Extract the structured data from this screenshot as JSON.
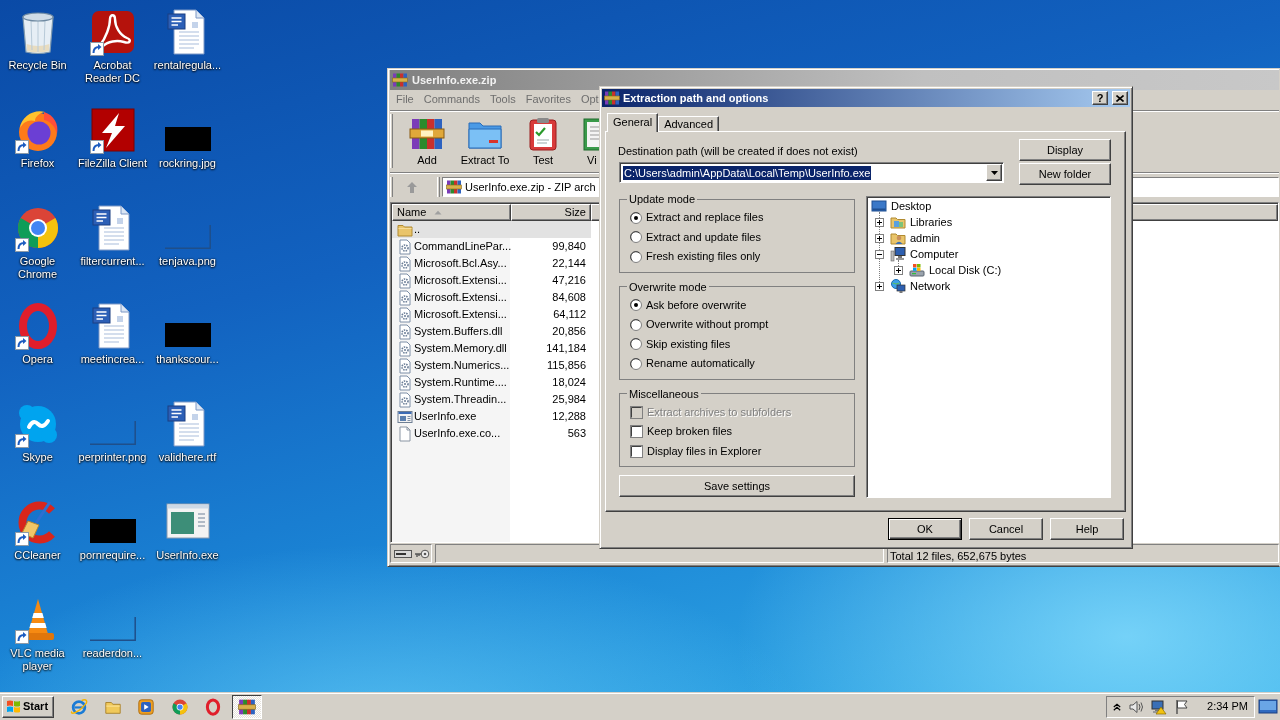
{
  "desktop": {
    "icons": [
      {
        "label": "Recycle Bin",
        "kind": "recycle-bin",
        "shortcut": false,
        "selected": false
      },
      {
        "label": "Firefox",
        "kind": "firefox",
        "shortcut": true,
        "selected": false
      },
      {
        "label": "Google Chrome",
        "kind": "chrome",
        "shortcut": true,
        "selected": false
      },
      {
        "label": "Opera",
        "kind": "opera",
        "shortcut": true,
        "selected": false
      },
      {
        "label": "Skype",
        "kind": "skype",
        "shortcut": true,
        "selected": false
      },
      {
        "label": "CCleaner",
        "kind": "ccleaner",
        "shortcut": true,
        "selected": false
      },
      {
        "label": "VLC media player",
        "kind": "vlc",
        "shortcut": true,
        "selected": false
      },
      {
        "label": "Acrobat Reader DC",
        "kind": "acrobat",
        "shortcut": true,
        "selected": false
      },
      {
        "label": "FileZilla Client",
        "kind": "filezilla",
        "shortcut": true,
        "selected": false
      },
      {
        "label": "filtercurrent...",
        "kind": "document",
        "shortcut": false,
        "selected": false
      },
      {
        "label": "meetincrea...",
        "kind": "document",
        "shortcut": false,
        "selected": false
      },
      {
        "label": "perprinter.png",
        "kind": "blank-image",
        "shortcut": false,
        "selected": false
      },
      {
        "label": "pornrequire...",
        "kind": "image",
        "shortcut": false,
        "selected": false
      },
      {
        "label": "readerdon...",
        "kind": "blank-image",
        "shortcut": false,
        "selected": false
      },
      {
        "label": "rentalregula...",
        "kind": "document",
        "shortcut": false,
        "selected": false
      },
      {
        "label": "rockring.jpg",
        "kind": "image",
        "shortcut": false,
        "selected": false
      },
      {
        "label": "tenjava.png",
        "kind": "blank-image",
        "shortcut": false,
        "selected": false
      },
      {
        "label": "thankscour...",
        "kind": "image",
        "shortcut": false,
        "selected": false
      },
      {
        "label": "validhere.rtf",
        "kind": "document",
        "shortcut": false,
        "selected": false
      },
      {
        "label": "UserInfo.exe",
        "kind": "program",
        "shortcut": false,
        "selected": false
      }
    ]
  },
  "archive": {
    "title": "UserInfo.exe.zip",
    "menu": [
      "File",
      "Commands",
      "Tools",
      "Favorites",
      "Opt"
    ],
    "toolbar": [
      {
        "label": "Add",
        "kind": "add"
      },
      {
        "label": "Extract To",
        "kind": "extract"
      },
      {
        "label": "Test",
        "kind": "test"
      },
      {
        "label": "Vi",
        "kind": "view"
      }
    ],
    "address": "UserInfo.exe.zip - ZIP arch",
    "columns": [
      {
        "label": "Name",
        "sorted": true
      },
      {
        "label": "Size",
        "sorted": false
      }
    ],
    "rows": [
      {
        "name": "..",
        "kind": "parent",
        "selected": true
      },
      {
        "name": "CommandLinePar...",
        "size": "99,840",
        "kind": "library",
        "selected": false
      },
      {
        "name": "Microsoft.Bcl.Asy...",
        "size": "22,144",
        "kind": "library",
        "selected": false
      },
      {
        "name": "Microsoft.Extensi...",
        "size": "47,216",
        "kind": "library",
        "selected": false
      },
      {
        "name": "Microsoft.Extensi...",
        "size": "84,608",
        "kind": "library",
        "selected": false
      },
      {
        "name": "Microsoft.Extensi...",
        "size": "64,112",
        "kind": "library",
        "selected": false
      },
      {
        "name": "System.Buffers.dll",
        "size": "20,856",
        "kind": "library",
        "selected": false
      },
      {
        "name": "System.Memory.dll",
        "size": "141,184",
        "kind": "library",
        "selected": false
      },
      {
        "name": "System.Numerics...",
        "size": "115,856",
        "kind": "library",
        "selected": false
      },
      {
        "name": "System.Runtime....",
        "size": "18,024",
        "kind": "library",
        "selected": false
      },
      {
        "name": "System.Threadin...",
        "size": "25,984",
        "kind": "library",
        "selected": false
      },
      {
        "name": "UserInfo.exe",
        "size": "12,288",
        "kind": "program",
        "selected": false
      },
      {
        "name": "UserInfo.exe.co...",
        "size": "563",
        "kind": "file",
        "selected": false
      }
    ],
    "status": "Total 12 files, 652,675 bytes"
  },
  "dialog": {
    "title": "Extraction path and options",
    "help_glyph": "?",
    "tabs": [
      {
        "label": "General",
        "selected": true
      },
      {
        "label": "Advanced",
        "selected": false
      }
    ],
    "destination": {
      "label": "Destination path (will be created if does not exist)",
      "value": "C:\\Users\\admin\\AppData\\Local\\Temp\\UserInfo.exe",
      "selected": true
    },
    "side_buttons": [
      "Display",
      "New folder"
    ],
    "groups": [
      {
        "title": "Update mode",
        "kind": "radio",
        "options": [
          {
            "label": "Extract and replace files",
            "selected": true
          },
          {
            "label": "Extract and update files",
            "selected": false
          },
          {
            "label": "Fresh existing files only",
            "selected": false
          }
        ]
      },
      {
        "title": "Overwrite mode",
        "kind": "radio",
        "options": [
          {
            "label": "Ask before overwrite",
            "selected": true
          },
          {
            "label": "Overwrite without prompt",
            "selected": false
          },
          {
            "label": "Skip existing files",
            "selected": false
          },
          {
            "label": "Rename automatically",
            "selected": false
          }
        ]
      },
      {
        "title": "Miscellaneous",
        "kind": "checkbox",
        "options": [
          {
            "label": "Extract archives to subfolders",
            "checked": false,
            "disabled": true
          },
          {
            "label": "Keep broken files",
            "checked": false,
            "disabled": false
          },
          {
            "label": "Display files in Explorer",
            "checked": false,
            "disabled": false
          }
        ]
      }
    ],
    "save_button": "Save settings",
    "tree": [
      {
        "label": "Desktop",
        "kind": "desktop",
        "selected": false,
        "children": [
          {
            "label": "Libraries",
            "kind": "libraries",
            "expanded": false,
            "selected": false
          },
          {
            "label": "admin",
            "kind": "user",
            "expanded": false,
            "selected": false
          },
          {
            "label": "Computer",
            "kind": "computer",
            "expanded": true,
            "selected": false,
            "children": [
              {
                "label": "Local Disk (C:)",
                "kind": "disk",
                "expanded": false,
                "selected": false
              }
            ]
          },
          {
            "label": "Network",
            "kind": "network",
            "expanded": false,
            "selected": false
          }
        ]
      }
    ],
    "buttons": [
      {
        "label": "OK",
        "default": true
      },
      {
        "label": "Cancel",
        "default": false
      },
      {
        "label": "Help",
        "default": false
      }
    ]
  },
  "taskbar": {
    "start": "Start",
    "apps": [
      {
        "kind": "ie",
        "active": false
      },
      {
        "kind": "explorer",
        "active": false
      },
      {
        "kind": "media-player",
        "active": false
      },
      {
        "kind": "chrome",
        "active": false
      },
      {
        "kind": "opera",
        "active": false
      },
      {
        "kind": "winrar",
        "active": true
      }
    ],
    "clock": "2:34 PM"
  }
}
